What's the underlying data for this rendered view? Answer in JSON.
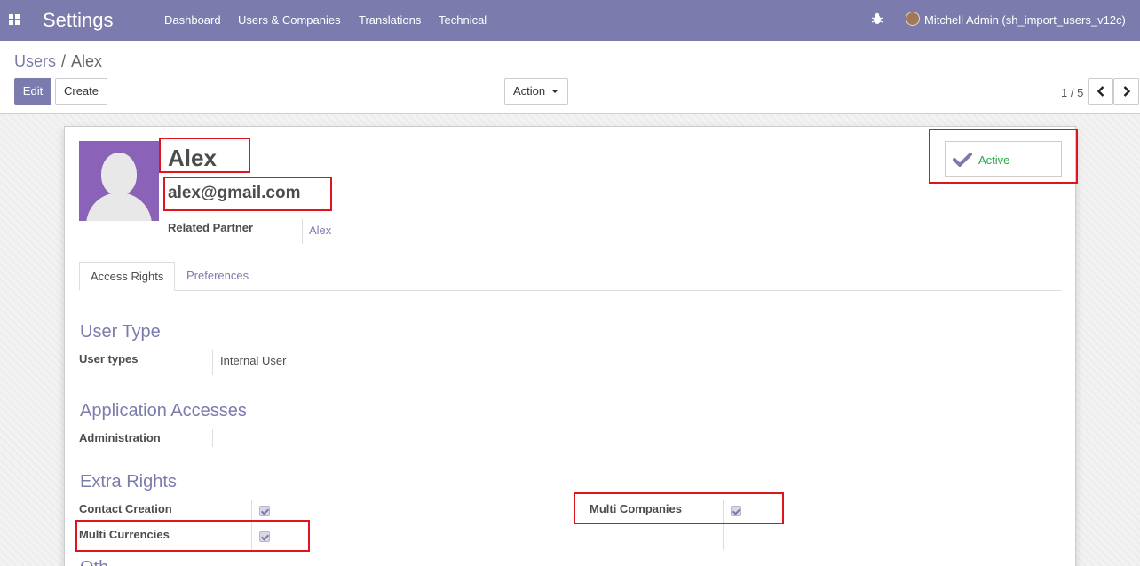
{
  "navbar": {
    "title": "Settings",
    "menu": [
      "Dashboard",
      "Users & Companies",
      "Translations",
      "Technical"
    ],
    "user": "Mitchell Admin (sh_import_users_v12c)"
  },
  "breadcrumb": {
    "parent": "Users",
    "separator": "/",
    "current": "Alex"
  },
  "toolbar": {
    "edit": "Edit",
    "create": "Create",
    "action": "Action",
    "pager": "1 / 5"
  },
  "record": {
    "name": "Alex",
    "email": "alex@gmail.com",
    "related_partner_label": "Related Partner",
    "related_partner_value": "Alex",
    "active_label": "Active"
  },
  "tabs": [
    "Access Rights",
    "Preferences"
  ],
  "sections": {
    "user_type": {
      "title": "User Type",
      "label": "User types",
      "value": "Internal User"
    },
    "app_access": {
      "title": "Application Accesses",
      "label": "Administration"
    },
    "extra": {
      "title": "Extra Rights",
      "contact_creation": "Contact Creation",
      "multi_currencies": "Multi Currencies",
      "multi_companies": "Multi Companies"
    },
    "other": {
      "title": "Oth"
    }
  },
  "colors": {
    "brand": "#7c7bad",
    "active": "#28a745",
    "highlight": "#e0141c"
  }
}
